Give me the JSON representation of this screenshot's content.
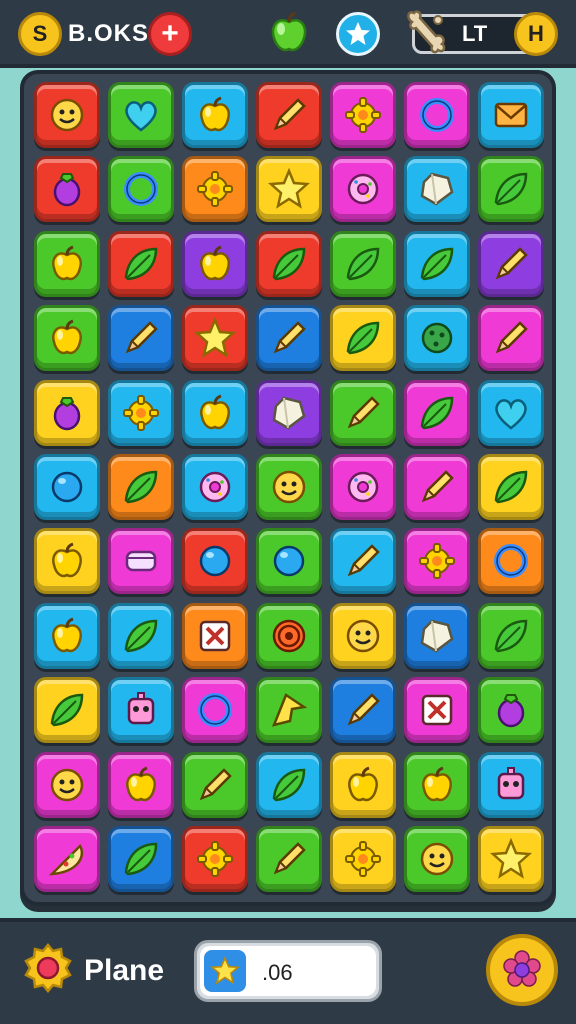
{
  "header": {
    "score_label": "B.OKS",
    "plus_label": "+",
    "level_label": "LT",
    "coin_glyph": "S",
    "h_glyph": "H"
  },
  "footer": {
    "mode_label": "Plane",
    "counter_value": ".06"
  },
  "colors": {
    "red": "#ef3b2b",
    "green": "#4cc92a",
    "blue": "#22b7ee",
    "yellow": "#ffd21f",
    "pink": "#f03ad6",
    "orange": "#ff8a1c",
    "purple": "#8e3ee0",
    "royal": "#1f7fe0"
  },
  "board": {
    "columns": 7,
    "rows": 11,
    "tiles": [
      [
        "red:face",
        "green:heart",
        "blue:apple",
        "red:pencil",
        "pink:gear",
        "pink:ring",
        "blue:envelope"
      ],
      [
        "red:eggplant",
        "green:ring",
        "orange:gear",
        "yellow:star",
        "pink:donut",
        "blue:gem",
        "green:leaf"
      ],
      [
        "green:apple",
        "red:leaf",
        "purple:apple",
        "red:leaf",
        "green:leaf",
        "blue:leaf",
        "purple:pencil"
      ],
      [
        "green:apple",
        "royal:pencil",
        "red:star",
        "royal:pencil",
        "yellow:leaf",
        "blue:cookie",
        "pink:pencil"
      ],
      [
        "yellow:eggplant",
        "blue:gear",
        "blue:apple",
        "purple:gem",
        "green:pencil",
        "pink:leaf",
        "blue:heart"
      ],
      [
        "blue:circle",
        "orange:leaf",
        "blue:donut",
        "green:face",
        "pink:donut",
        "pink:pencil",
        "yellow:leaf"
      ],
      [
        "yellow:apple",
        "pink:box",
        "red:circle",
        "green:circle",
        "blue:pencil",
        "pink:gear",
        "orange:ring"
      ],
      [
        "blue:apple",
        "blue:leaf",
        "orange:cross",
        "green:target",
        "yellow:face",
        "royal:gem",
        "green:leaf"
      ],
      [
        "yellow:leaf",
        "blue:robot",
        "pink:ring",
        "green:arrow",
        "royal:pencil",
        "pink:cross",
        "green:eggplant"
      ],
      [
        "pink:face",
        "pink:apple",
        "green:pencil",
        "blue:leaf",
        "yellow:apple",
        "green:apple",
        "blue:robot"
      ],
      [
        "pink:pizza",
        "royal:leaf",
        "red:gear",
        "green:pencil",
        "yellow:gear",
        "green:face",
        "yellow:star"
      ]
    ]
  }
}
